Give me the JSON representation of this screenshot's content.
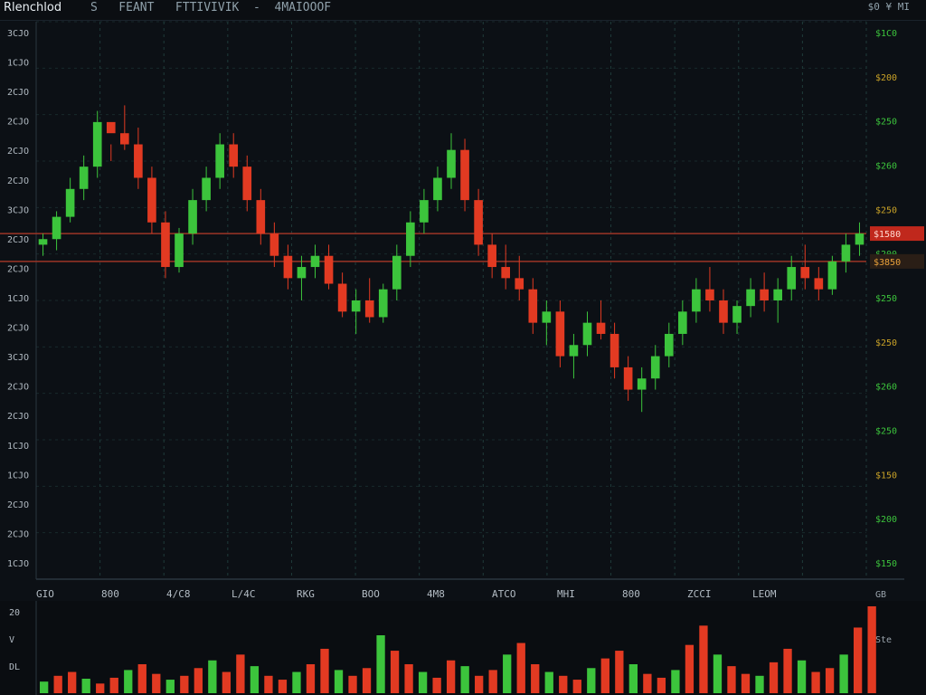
{
  "header": {
    "title": "Rlenchlod",
    "meta": "S   FEANT   FTTIVIVIK  -  4MAIOOOF",
    "right": "$0   ¥ MI"
  },
  "colors": {
    "background": "#0c1015",
    "grid": "#1f3b3a",
    "up": "#3cc43c",
    "down": "#e23a22",
    "level_line": "#9b3526",
    "price_tag_red": "#c0281c",
    "price_tag_green": "#1f7a3a"
  },
  "chart_data": [
    {
      "type": "candlestick",
      "title": "",
      "y_ticks": [
        "3CJO",
        "1CJO",
        "2CJO",
        "2CJO",
        "2CJO",
        "2CJO",
        "3CJO",
        "2CJO",
        "2CJO",
        "1CJO",
        "2CJO",
        "3CJO",
        "2CJO",
        "2CJO",
        "1CJO",
        "1CJO",
        "2CJO",
        "2CJO",
        "1CJO"
      ],
      "right_ticks": [
        "$1C0",
        "$200",
        "$250",
        "$260",
        "$250",
        "$200",
        "$250",
        "$250",
        "$260",
        "$250",
        "$150",
        "$200",
        "$150"
      ],
      "price_tag_red": "$1580",
      "price_tag_orange": "$3850",
      "x_ticks": [
        "GIO",
        "800",
        "4/C8",
        "L/4C",
        "RKG",
        "BOO",
        "4M8",
        "ATCO",
        "MHI",
        "800",
        "ZCCI",
        "LEOM"
      ],
      "ylim": [
        0,
        100
      ],
      "levels": [
        62,
        57
      ],
      "grid": true,
      "series": [
        {
          "values": [
            [
              60,
              62,
              58,
              61
            ],
            [
              61,
              66,
              59,
              65
            ],
            [
              65,
              72,
              64,
              70
            ],
            [
              70,
              76,
              68,
              74
            ],
            [
              74,
              84,
              72,
              82
            ],
            [
              82,
              78,
              75,
              80
            ],
            [
              80,
              85,
              77,
              78
            ],
            [
              78,
              81,
              70,
              72
            ],
            [
              72,
              74,
              62,
              64
            ],
            [
              64,
              66,
              54,
              56
            ],
            [
              56,
              63,
              55,
              62
            ],
            [
              62,
              70,
              60,
              68
            ],
            [
              68,
              74,
              66,
              72
            ],
            [
              72,
              80,
              70,
              78
            ],
            [
              78,
              80,
              72,
              74
            ],
            [
              74,
              76,
              66,
              68
            ],
            [
              68,
              70,
              60,
              62
            ],
            [
              62,
              64,
              56,
              58
            ],
            [
              58,
              60,
              52,
              54
            ],
            [
              54,
              58,
              50,
              56
            ],
            [
              56,
              60,
              54,
              58
            ],
            [
              58,
              60,
              52,
              53
            ],
            [
              53,
              55,
              47,
              48
            ],
            [
              48,
              52,
              44,
              50
            ],
            [
              50,
              54,
              46,
              47
            ],
            [
              47,
              53,
              46,
              52
            ],
            [
              52,
              60,
              50,
              58
            ],
            [
              58,
              66,
              56,
              64
            ],
            [
              64,
              70,
              62,
              68
            ],
            [
              68,
              74,
              66,
              72
            ],
            [
              72,
              80,
              70,
              77
            ],
            [
              77,
              79,
              66,
              68
            ],
            [
              68,
              70,
              58,
              60
            ],
            [
              60,
              62,
              54,
              56
            ],
            [
              56,
              60,
              52,
              54
            ],
            [
              54,
              58,
              50,
              52
            ],
            [
              52,
              54,
              44,
              46
            ],
            [
              46,
              50,
              42,
              48
            ],
            [
              48,
              50,
              38,
              40
            ],
            [
              40,
              44,
              36,
              42
            ],
            [
              42,
              48,
              40,
              46
            ],
            [
              46,
              50,
              43,
              44
            ],
            [
              44,
              46,
              36,
              38
            ],
            [
              38,
              40,
              32,
              34
            ],
            [
              34,
              38,
              30,
              36
            ],
            [
              36,
              42,
              34,
              40
            ],
            [
              40,
              46,
              38,
              44
            ],
            [
              44,
              50,
              42,
              48
            ],
            [
              48,
              54,
              46,
              52
            ],
            [
              52,
              56,
              48,
              50
            ],
            [
              50,
              52,
              44,
              46
            ],
            [
              46,
              50,
              44,
              49
            ],
            [
              49,
              54,
              47,
              52
            ],
            [
              52,
              55,
              48,
              50
            ],
            [
              50,
              54,
              46,
              52
            ],
            [
              52,
              58,
              50,
              56
            ],
            [
              56,
              60,
              52,
              54
            ],
            [
              54,
              56,
              50,
              52
            ],
            [
              52,
              58,
              51,
              57
            ],
            [
              57,
              62,
              55,
              60
            ],
            [
              60,
              64,
              58,
              62
            ]
          ]
        }
      ]
    },
    {
      "type": "bar",
      "title": "",
      "y_ticks": [
        "20",
        "V",
        "DL"
      ],
      "right_ticks": [
        "GB",
        "Ste"
      ],
      "values": [
        12,
        18,
        22,
        15,
        10,
        16,
        24,
        30,
        20,
        14,
        18,
        26,
        34,
        22,
        40,
        28,
        18,
        14,
        22,
        30,
        46,
        24,
        18,
        26,
        60,
        44,
        30,
        22,
        16,
        34,
        28,
        18,
        24,
        40,
        52,
        30,
        22,
        18,
        14,
        26,
        36,
        44,
        30,
        20,
        16,
        24,
        50,
        70,
        40,
        28,
        20,
        18,
        32,
        46,
        34,
        22,
        26,
        40,
        68,
        90
      ],
      "series": [
        {
          "values": []
        }
      ]
    }
  ]
}
